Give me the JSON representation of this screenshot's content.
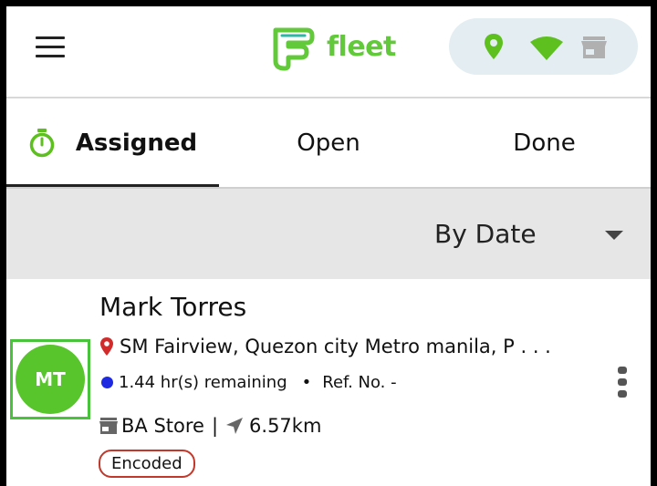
{
  "header": {
    "logo_text": "fleet",
    "brand_color": "#62c93a",
    "status_icons": [
      "location-pin-icon",
      "wifi-icon",
      "store-icon"
    ]
  },
  "tabs": [
    {
      "label": "Assigned",
      "active": true,
      "icon": "timer-icon"
    },
    {
      "label": "Open",
      "active": false
    },
    {
      "label": "Done",
      "active": false
    }
  ],
  "filter": {
    "sort_value": "By Date"
  },
  "job": {
    "avatar_initials": "MT",
    "name": "Mark Torres",
    "address": "SM Fairview, Quezon city Metro manila, P . . .",
    "time_remaining": "1.44 hr(s) remaining",
    "bullet": "•",
    "ref_no": "Ref. No. -",
    "store": "BA Store",
    "divider": "|",
    "distance": "6.57km",
    "status": "Encoded",
    "status_color": "#c0392b"
  }
}
